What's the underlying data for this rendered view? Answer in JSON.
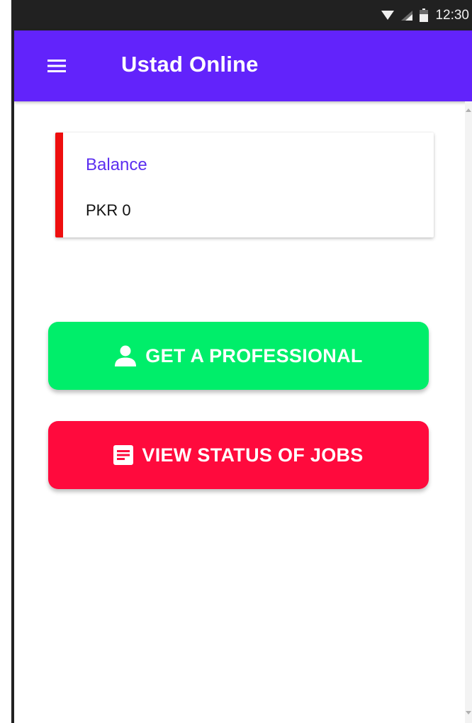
{
  "status_bar": {
    "time": "12:30",
    "icons": [
      "wifi-icon",
      "signal-icon",
      "battery-icon"
    ]
  },
  "app_bar": {
    "title": "Ustad Online",
    "menu_icon": "hamburger-menu-icon",
    "color": "#6223fb"
  },
  "balance_card": {
    "label": "Balance",
    "value": "PKR 0",
    "accent_color": "#ee0e0e"
  },
  "actions": [
    {
      "label": "GET A PROFESSIONAL",
      "icon": "person-icon",
      "color": "#00ee6a"
    },
    {
      "label": "VIEW STATUS OF JOBS",
      "icon": "document-list-icon",
      "color": "#ff0a3d"
    }
  ]
}
